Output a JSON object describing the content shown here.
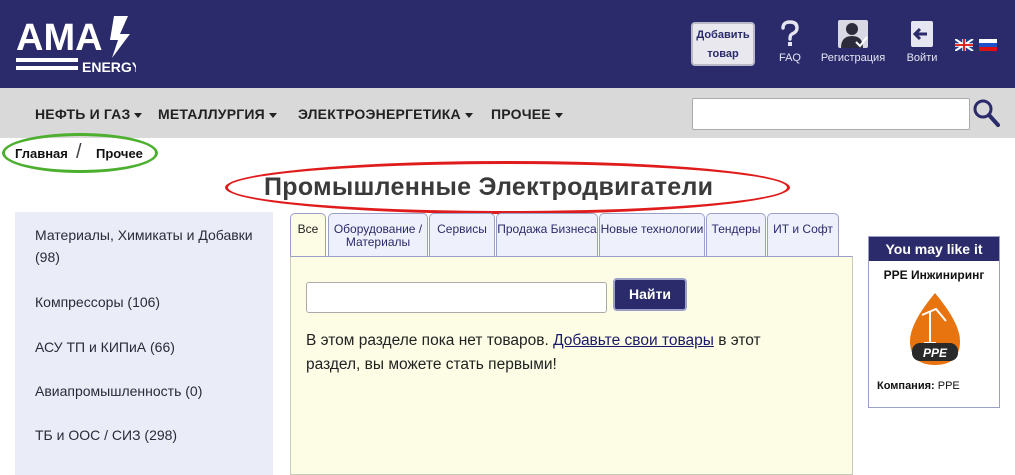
{
  "header": {
    "logo_text": "AMA",
    "logo_sub": "ENERGY",
    "add_button_label": "Добавить товар",
    "faq_label": "FAQ",
    "register_label": "Регистрация",
    "login_label": "Войти",
    "bg_color": "#2b2b6b"
  },
  "nav": {
    "items": [
      "НЕФТЬ И ГАЗ",
      "МЕТАЛЛУРГИЯ",
      "ЭЛЕКТРОЭНЕРГЕТИКА",
      "ПРОЧЕЕ"
    ],
    "search_value": ""
  },
  "breadcrumb": {
    "home": "Главная",
    "separator": "/",
    "current": "Прочее"
  },
  "page_title": "Промышленные Электродвигатели",
  "sidebar": {
    "items": [
      "Материалы, Химикаты и Добавки (98)",
      "Компрессоры (106)",
      "АСУ ТП и КИПиА (66)",
      "Авиапромышленность (0)",
      "ТБ и ООС / СИЗ (298)"
    ]
  },
  "tabs": [
    "Все",
    "Оборудование / Материалы",
    "Сервисы",
    "Продажа Бизнеса",
    "Новые технологии",
    "Тендеры",
    "ИТ и Софт"
  ],
  "panel": {
    "search_value": "",
    "search_button": "Найти",
    "empty_prefix": "В этом разделе пока нет товаров. ",
    "empty_link": "Добавьте свои товары",
    "empty_suffix": " в этот раздел, вы можете стать первыми!"
  },
  "ad": {
    "header": "You may like it",
    "company_name": "PPE Инжиниринг",
    "logo_text": "PPE",
    "company_label": "Компания:",
    "company_value": "PPE"
  }
}
